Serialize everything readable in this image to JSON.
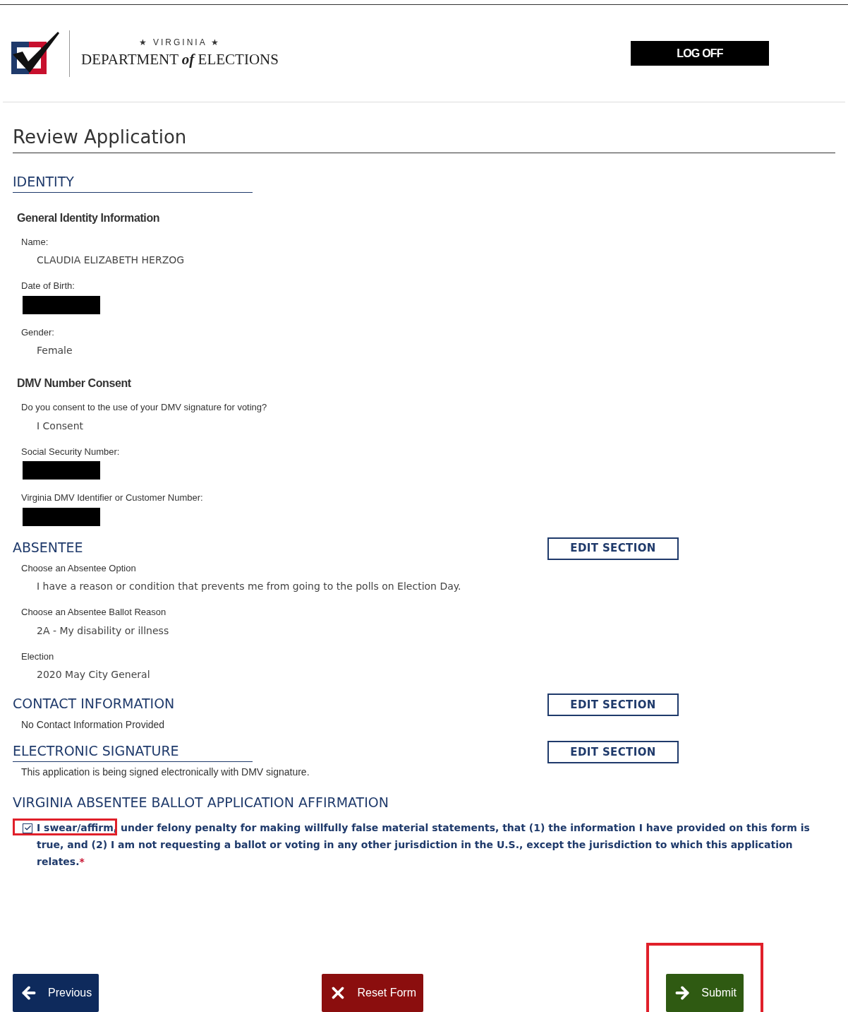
{
  "header": {
    "logo_top": "★ VIRGINIA ★",
    "logo_main": "DEPARTMENT",
    "logo_of": "of",
    "logo_end": "ELECTIONS",
    "logoff": "LOG OFF"
  },
  "title": "Review Application",
  "sections": [
    {
      "heading": "IDENTITY",
      "underlined": true,
      "groups": [
        {
          "subheading": "General Identity Information",
          "fields": [
            {
              "label": "Name:",
              "value": "CLAUDIA ELIZABETH HERZOG",
              "redacted": false
            },
            {
              "label": "Date of Birth:",
              "redacted": true
            },
            {
              "label": "Gender:",
              "value": "Female",
              "redacted": false
            }
          ]
        },
        {
          "subheading": "DMV Number Consent",
          "fields": [
            {
              "label": "Do you consent to the use of your DMV signature for voting?",
              "value": "I Consent",
              "redacted": false
            },
            {
              "label": "Social Security Number:",
              "redacted": true
            },
            {
              "label": "Virginia DMV Identifier or Customer Number:",
              "redacted": true
            }
          ]
        }
      ]
    },
    {
      "heading": "ABSENTEE",
      "underlined": false,
      "edit": "EDIT SECTION",
      "groups": [
        {
          "fields": [
            {
              "label": "Choose an Absentee Option",
              "value": "I have a reason or condition that prevents me from going to the polls on Election Day.",
              "redacted": false
            },
            {
              "label": "Choose an Absentee Ballot Reason",
              "value": "2A - My disability or illness",
              "redacted": false
            },
            {
              "label": "Election",
              "value": "2020 May City General",
              "redacted": false
            }
          ]
        }
      ]
    },
    {
      "heading": "CONTACT INFORMATION",
      "underlined": false,
      "edit": "EDIT SECTION",
      "note": "No Contact Information Provided"
    },
    {
      "heading": "ELECTRONIC SIGNATURE",
      "underlined": true,
      "edit": "EDIT SECTION",
      "note": "This application is being signed electronically with DMV signature."
    }
  ],
  "affirmation": {
    "heading": "VIRGINIA ABSENTEE BALLOT APPLICATION AFFIRMATION",
    "checked": true,
    "highlighted": true,
    "text": "I swear/affirm, under felony penalty for making willfully false material statements, that (1) the information I have provided on this form is true, and (2) I am not requesting a ballot or voting in any other jurisdiction in the U.S., except the jurisdiction to which this application relates.",
    "required": "*"
  },
  "buttons": [
    {
      "kind": "previous",
      "label": "Previous",
      "highlighted": false
    },
    {
      "kind": "reset",
      "label": "Reset Form",
      "highlighted": false
    },
    {
      "kind": "submit",
      "label": "Submit",
      "highlighted": true
    }
  ]
}
